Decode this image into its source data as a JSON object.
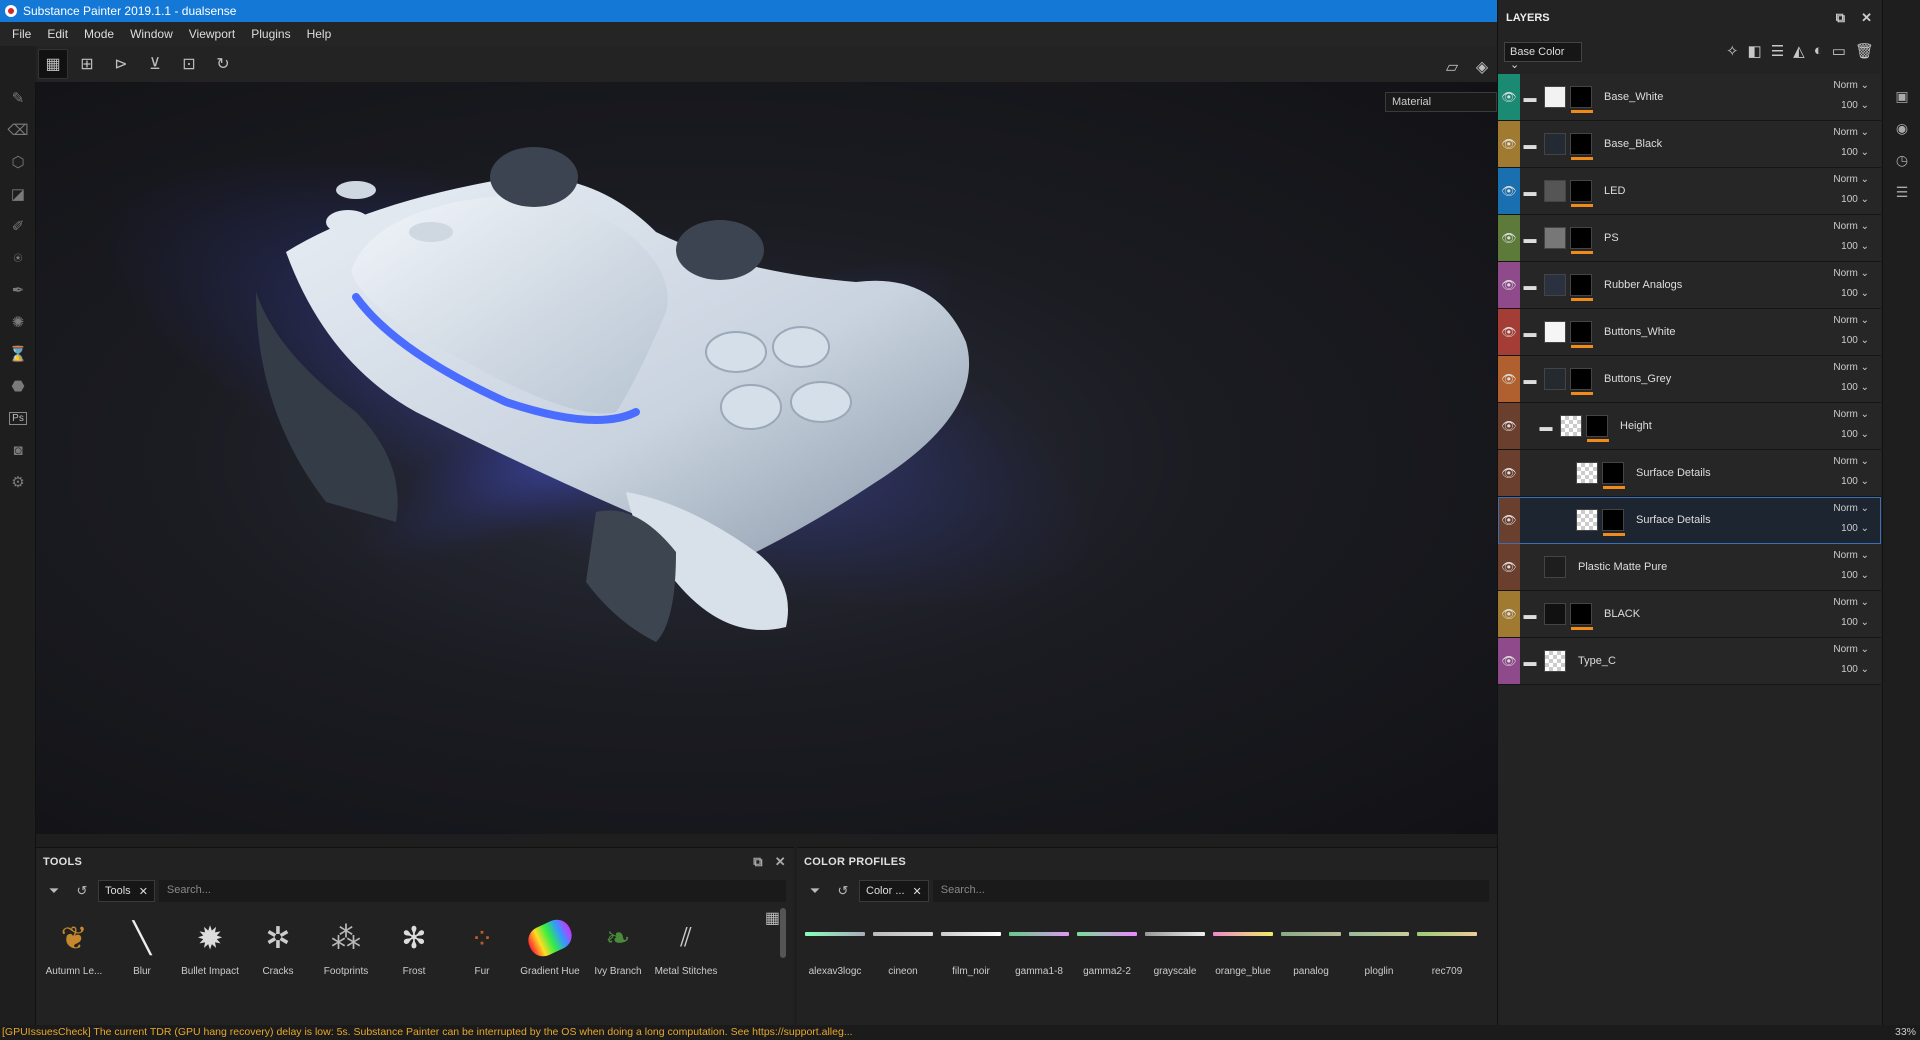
{
  "app": {
    "title": "Substance Painter 2019.1.1 - dualsense"
  },
  "menu": [
    "File",
    "Edit",
    "Mode",
    "Window",
    "Viewport",
    "Plugins",
    "Help"
  ],
  "viewport": {
    "material_mode": "Material"
  },
  "tools_panel": {
    "title": "TOOLS",
    "filter_tag": "Tools",
    "search_placeholder": "Search...",
    "items": [
      "Autumn Le...",
      "Blur",
      "Bullet Impact",
      "Cracks",
      "Footprints",
      "Frost",
      "Fur",
      "Gradient Hue",
      "Ivy Branch",
      "Metal Stitches"
    ]
  },
  "profiles_panel": {
    "title": "COLOR PROFILES",
    "filter_tag": "Color ...",
    "search_placeholder": "Search...",
    "items": [
      "alexav3logc",
      "cineon",
      "film_noir",
      "gamma1-8",
      "gamma2-2",
      "grayscale",
      "orange_blue",
      "panalog",
      "ploglin",
      "rec709"
    ]
  },
  "layers_panel": {
    "title": "LAYERS",
    "channel": "Base Color",
    "layers": [
      {
        "name": "Base_White",
        "blend": "Norm",
        "opacity": "100",
        "color": "#1a8a73"
      },
      {
        "name": "Base_Black",
        "blend": "Norm",
        "opacity": "100",
        "color": "#a17a32"
      },
      {
        "name": "LED",
        "blend": "Norm",
        "opacity": "100",
        "color": "#1a6fb0"
      },
      {
        "name": "PS",
        "blend": "Norm",
        "opacity": "100",
        "color": "#5e7a3b"
      },
      {
        "name": "Rubber Analogs",
        "blend": "Norm",
        "opacity": "100",
        "color": "#8e4a8a"
      },
      {
        "name": "Buttons_White",
        "blend": "Norm",
        "opacity": "100",
        "color": "#a33d35"
      },
      {
        "name": "Buttons_Grey",
        "blend": "Norm",
        "opacity": "100",
        "color": "#b0602f"
      },
      {
        "name": "Height",
        "blend": "Norm",
        "opacity": "100",
        "color": "#6a3f2e"
      },
      {
        "name": "Surface Details",
        "blend": "Norm",
        "opacity": "100",
        "color": "#6a3f2e"
      },
      {
        "name": "Surface Details",
        "blend": "Norm",
        "opacity": "100",
        "color": "#6a3f2e"
      },
      {
        "name": "Plastic Matte Pure",
        "blend": "Norm",
        "opacity": "100",
        "color": "#6a3f2e"
      },
      {
        "name": "BLACK",
        "blend": "Norm",
        "opacity": "100",
        "color": "#a17a32"
      },
      {
        "name": "Type_C",
        "blend": "Norm",
        "opacity": "100",
        "color": "#8e4a8a"
      }
    ]
  },
  "status": {
    "message": "[GPUIssuesCheck] The current TDR (GPU hang recovery) delay is low: 5s. Substance Painter can be interrupted by the OS when doing a long computation. See https://support.alleg...",
    "zoom": "33%"
  }
}
